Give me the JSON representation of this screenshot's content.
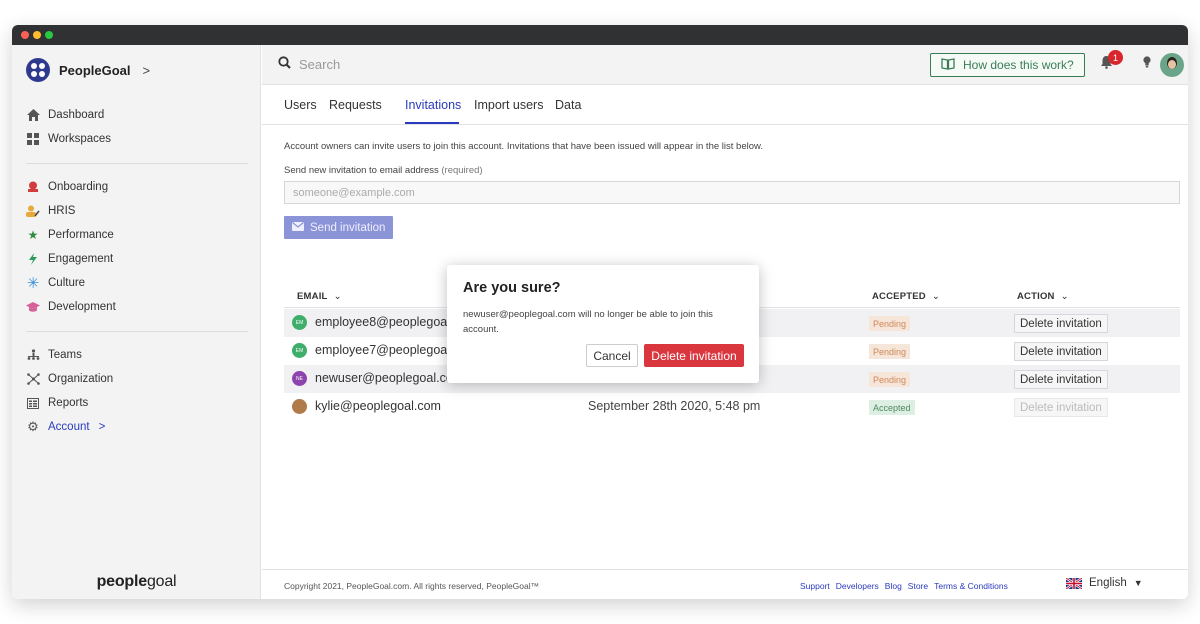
{
  "brand": {
    "name": "PeopleGoal",
    "chevron": ">"
  },
  "sidebar": {
    "group1": [
      {
        "label": "Dashboard",
        "icon": "home-icon"
      },
      {
        "label": "Workspaces",
        "icon": "grid-icon"
      }
    ],
    "group2": [
      {
        "label": "Onboarding",
        "icon": "onboarding-icon"
      },
      {
        "label": "HRIS",
        "icon": "people-icon"
      },
      {
        "label": "Performance",
        "icon": "star-icon"
      },
      {
        "label": "Engagement",
        "icon": "bolt-icon"
      },
      {
        "label": "Culture",
        "icon": "asterisk-icon"
      },
      {
        "label": "Development",
        "icon": "graduation-cap-icon"
      }
    ],
    "group3": [
      {
        "label": "Teams",
        "icon": "teams-icon"
      },
      {
        "label": "Organization",
        "icon": "org-icon"
      },
      {
        "label": "Reports",
        "icon": "reports-icon"
      },
      {
        "label": "Account",
        "icon": "gear-icon",
        "chevron": ">"
      }
    ],
    "footer_logo_bold": "people",
    "footer_logo_light": "goal"
  },
  "topbar": {
    "search_placeholder": "Search",
    "how_label": "How does this work?",
    "notification_count": "1"
  },
  "tabs": [
    "Users",
    "Requests",
    "Invitations",
    "Import users",
    "Data"
  ],
  "active_tab": "Invitations",
  "invite": {
    "description": "Account owners can invite users to join this account. Invitations that have been issued will appear in the list below.",
    "label": "Send new invitation to email address",
    "label_required": "(required)",
    "placeholder": "someone@example.com",
    "send_label": "Send invitation"
  },
  "table": {
    "headers": {
      "email": "EMAIL",
      "accepted": "ACCEPTED",
      "action": "ACTION"
    },
    "rows": [
      {
        "initials": "EM",
        "email": "employee8@peoplegoal.c",
        "date": "",
        "status": "Pending",
        "action": "Delete invitation",
        "color": "#3fae6a"
      },
      {
        "initials": "EM",
        "email": "employee7@peoplegoal.c",
        "date": "",
        "status": "Pending",
        "action": "Delete invitation",
        "color": "#3fae6a"
      },
      {
        "initials": "NE",
        "email": "newuser@peoplegoal.cor",
        "date": "",
        "status": "Pending",
        "action": "Delete invitation",
        "color": "#8e44ad"
      },
      {
        "initials": "",
        "email": "kylie@peoplegoal.com",
        "date": "September 28th 2020, 5:48 pm",
        "status": "Accepted",
        "action": "Delete invitation",
        "color": "#b07a4a"
      }
    ]
  },
  "footer": {
    "copyright": "Copyright 2021, PeopleGoal.com. All rights reserved, PeopleGoal™",
    "links": [
      "Support",
      "Developers",
      "Blog",
      "Store",
      "Terms & Conditions"
    ],
    "language": "English"
  },
  "modal": {
    "title": "Are you sure?",
    "body": "newuser@peoplegoal.com will no longer be able to join this account.",
    "cancel_label": "Cancel",
    "confirm_label": "Delete invitation"
  },
  "colors": {
    "accent": "#2b3bbd",
    "danger": "#d9363e",
    "success": "#3a7d55"
  }
}
